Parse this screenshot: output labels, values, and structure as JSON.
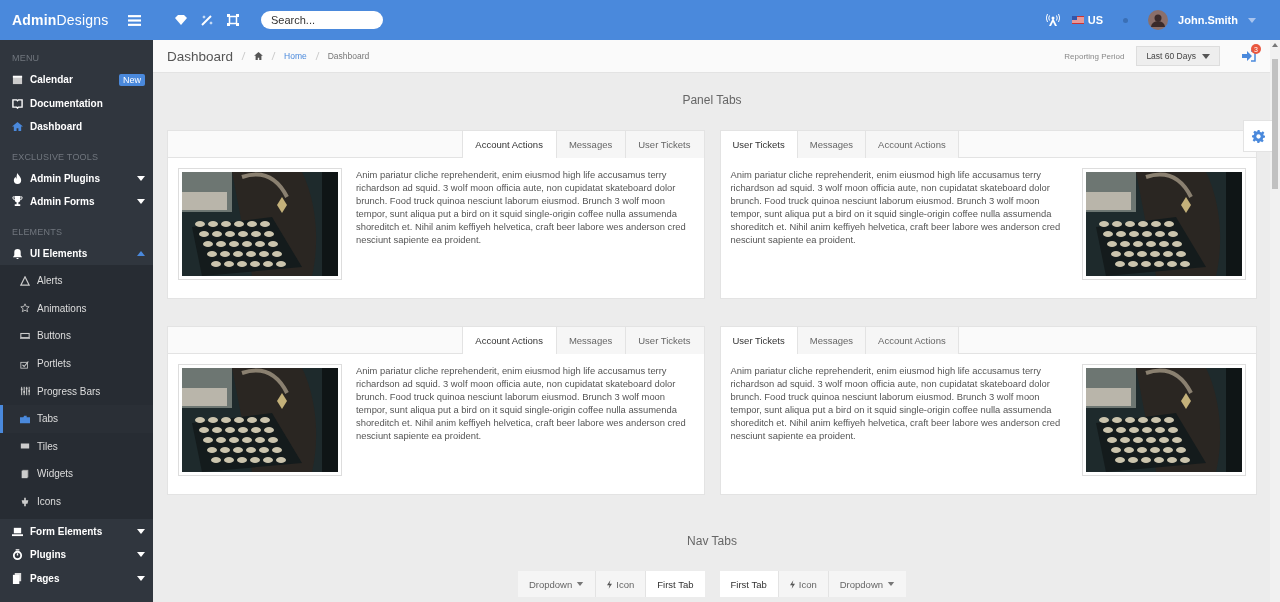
{
  "header": {
    "logo": "**Admin**Designs",
    "search": {
      "placeholder": "Search..."
    },
    "language": "US",
    "user": "John.Smith"
  },
  "sidebar": {
    "sections": [
      {
        "label": "MENU",
        "items": [
          {
            "label": "Calendar",
            "badge": "New",
            "selected": false
          },
          {
            "label": "Documentation",
            "selected": false
          },
          {
            "label": "Dashboard",
            "selected": false
          }
        ]
      },
      {
        "label": "EXCLUSIVE TOOLS",
        "items": [
          {
            "label": "Admin Plugins",
            "expanded": false,
            "selected": false
          },
          {
            "label": "Admin Forms",
            "expanded": false,
            "selected": false
          }
        ]
      },
      {
        "label": "ELEMENTS",
        "items": [
          {
            "label": "UI Elements",
            "expanded": true,
            "selected": false,
            "children": [
              {
                "label": "Alerts",
                "selected": false
              },
              {
                "label": "Animations",
                "selected": false
              },
              {
                "label": "Buttons",
                "selected": false
              },
              {
                "label": "Portlets",
                "selected": false
              },
              {
                "label": "Progress Bars",
                "selected": false
              },
              {
                "label": "Tabs",
                "selected": true
              },
              {
                "label": "Tiles",
                "selected": false
              },
              {
                "label": "Widgets",
                "selected": false
              },
              {
                "label": "Icons",
                "selected": false
              }
            ]
          },
          {
            "label": "Form Elements",
            "expanded": false,
            "selected": false
          },
          {
            "label": "Plugins",
            "expanded": false,
            "selected": false
          },
          {
            "label": "Pages",
            "expanded": false,
            "selected": false
          }
        ]
      }
    ]
  },
  "topbar": {
    "title": "Dashboard",
    "breadcrumb": [
      "Home",
      "Dashboard"
    ],
    "reporting_label": "Reporting Period",
    "period": "Last 60 Days",
    "notifications": "3"
  },
  "panel_tabs": {
    "title": "Panel Tabs",
    "panels": [
      {
        "image_right": false,
        "tabs_right": true,
        "tabs": [
          {
            "label": "Account Actions",
            "selected": true
          },
          {
            "label": "Messages",
            "selected": false
          },
          {
            "label": "User Tickets",
            "selected": false
          }
        ],
        "text": "Anim pariatur cliche reprehenderit, enim eiusmod high life accusamus terry richardson ad squid. 3 wolf moon officia aute, non cupidatat skateboard dolor brunch. Food truck quinoa nesciunt laborum eiusmod. Brunch 3 wolf moon tempor, sunt aliqua put a bird on it squid single-origin coffee nulla assumenda shoreditch et. Nihil anim keffiyeh helvetica, craft beer labore wes anderson cred nesciunt sapiente ea proident."
      },
      {
        "image_right": true,
        "tabs_right": false,
        "tabs": [
          {
            "label": "User Tickets",
            "selected": true
          },
          {
            "label": "Messages",
            "selected": false
          },
          {
            "label": "Account Actions",
            "selected": false
          }
        ],
        "text": "Anim pariatur cliche reprehenderit, enim eiusmod high life accusamus terry richardson ad squid. 3 wolf moon officia aute, non cupidatat skateboard dolor brunch. Food truck quinoa nesciunt laborum eiusmod. Brunch 3 wolf moon tempor, sunt aliqua put a bird on it squid single-origin coffee nulla assumenda shoreditch et. Nihil anim keffiyeh helvetica, craft beer labore wes anderson cred nesciunt sapiente ea proident."
      },
      {
        "image_right": false,
        "tabs_right": true,
        "tabs": [
          {
            "label": "Account Actions",
            "selected": true
          },
          {
            "label": "Messages",
            "selected": false
          },
          {
            "label": "User Tickets",
            "selected": false
          }
        ],
        "text": "Anim pariatur cliche reprehenderit, enim eiusmod high life accusamus terry richardson ad squid. 3 wolf moon officia aute, non cupidatat skateboard dolor brunch. Food truck quinoa nesciunt laborum eiusmod. Brunch 3 wolf moon tempor, sunt aliqua put a bird on it squid single-origin coffee nulla assumenda shoreditch et. Nihil anim keffiyeh helvetica, craft beer labore wes anderson cred nesciunt sapiente ea proident."
      },
      {
        "image_right": true,
        "tabs_right": false,
        "tabs": [
          {
            "label": "User Tickets",
            "selected": true
          },
          {
            "label": "Messages",
            "selected": false
          },
          {
            "label": "Account Actions",
            "selected": false
          }
        ],
        "text": "Anim pariatur cliche reprehenderit, enim eiusmod high life accusamus terry richardson ad squid. 3 wolf moon officia aute, non cupidatat skateboard dolor brunch. Food truck quinoa nesciunt laborum eiusmod. Brunch 3 wolf moon tempor, sunt aliqua put a bird on it squid single-origin coffee nulla assumenda shoreditch et. Nihil anim keffiyeh helvetica, craft beer labore wes anderson cred nesciunt sapiente ea proident."
      }
    ]
  },
  "nav_tabs": {
    "title": "Nav Tabs",
    "groups": [
      {
        "align_right": true,
        "tabs": [
          {
            "kind": "dropdown",
            "label": "Dropdown",
            "selected": false
          },
          {
            "kind": "icon",
            "label": "Icon",
            "selected": false
          },
          {
            "kind": "text",
            "label": "First Tab",
            "selected": true
          }
        ]
      },
      {
        "align_right": false,
        "tabs": [
          {
            "kind": "text",
            "label": "First Tab",
            "selected": true
          },
          {
            "kind": "icon",
            "label": "Icon",
            "selected": false
          },
          {
            "kind": "dropdown",
            "label": "Dropdown",
            "selected": false
          }
        ]
      }
    ]
  }
}
